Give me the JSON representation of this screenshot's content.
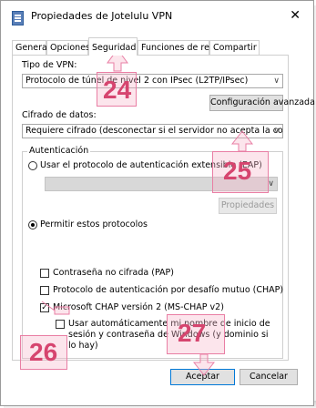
{
  "window": {
    "title": "Propiedades de Jotelulu VPN",
    "close": "✕"
  },
  "tabs": [
    "General",
    "Opciones",
    "Seguridad",
    "Funciones de red",
    "Compartir"
  ],
  "vpn_type": {
    "label": "Tipo de VPN:",
    "value": "Protocolo de túnel de nivel 2 con IPsec (L2TP/IPsec)",
    "advanced_button": "Configuración avanzada"
  },
  "encryption": {
    "label": "Cifrado de datos:",
    "value": "Requiere cifrado (desconectar si el servidor no acepta la conex"
  },
  "auth": {
    "legend": "Autenticación",
    "eap_radio": "Usar el protocolo de autenticación extensible (EAP)",
    "eap_select": "",
    "properties_button": "Propiedades",
    "allow_radio": "Permitir estos protocolos",
    "pap": "Contraseña no cifrada (PAP)",
    "chap": "Protocolo de autenticación por desafío mutuo (CHAP)",
    "mschap": "Microsoft CHAP versión 2 (MS-CHAP v2)",
    "auto_use": "Usar automáticamente mi nombre de inicio de sesión y contraseña de Windows (y dominio si lo hay)"
  },
  "buttons": {
    "ok": "Aceptar",
    "cancel": "Cancelar"
  },
  "annotations": [
    "24",
    "25",
    "26",
    "27"
  ],
  "colors": {
    "annotation": "#d6456f",
    "primary_border": "#0078d7"
  }
}
